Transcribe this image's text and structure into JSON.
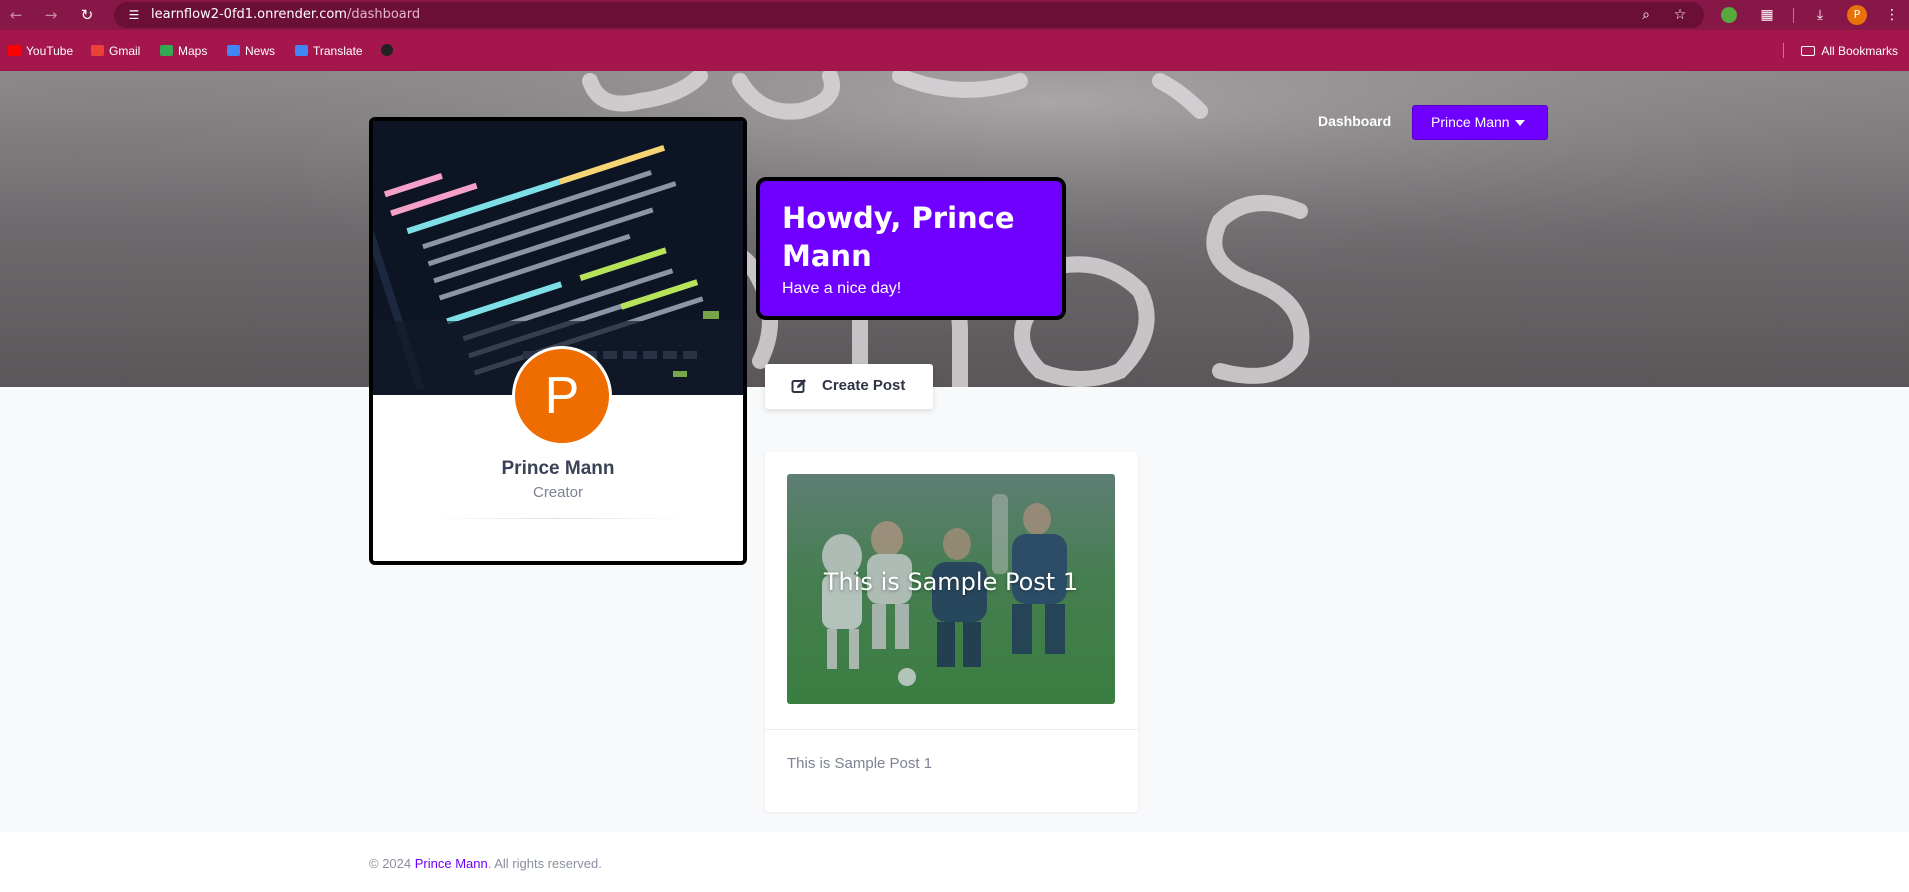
{
  "browser": {
    "url_host": "learnflow2-0fd1.onrender.com",
    "url_path": "/dashboard",
    "profile_initial": "P",
    "bookmarks": [
      {
        "label": "YouTube",
        "color": "#ff0000"
      },
      {
        "label": "Gmail",
        "color": "#ea4335"
      },
      {
        "label": "Maps",
        "color": "#34a853"
      },
      {
        "label": "News",
        "color": "#4285f4"
      },
      {
        "label": "Translate",
        "color": "#4285f4"
      }
    ],
    "all_bookmarks": "All Bookmarks"
  },
  "nav": {
    "dashboard": "Dashboard",
    "user_menu": "Prince Mann"
  },
  "profile": {
    "initial": "P",
    "name": "Prince Mann",
    "role": "Creator"
  },
  "greeting": {
    "title": "Howdy, Prince Mann",
    "subtitle": "Have a nice day!"
  },
  "actions": {
    "create_post": "Create Post"
  },
  "posts": [
    {
      "image_title": "This is Sample Post 1",
      "text": "This is Sample Post 1"
    }
  ],
  "footer": {
    "prefix": "© 2024 ",
    "name": "Prince Mann",
    "suffix": ". All rights reserved."
  },
  "colors": {
    "accent": "#6f00ff",
    "avatar": "#ef6c00",
    "chrome_top": "#861746",
    "chrome_bookmarks": "#a5164d"
  }
}
